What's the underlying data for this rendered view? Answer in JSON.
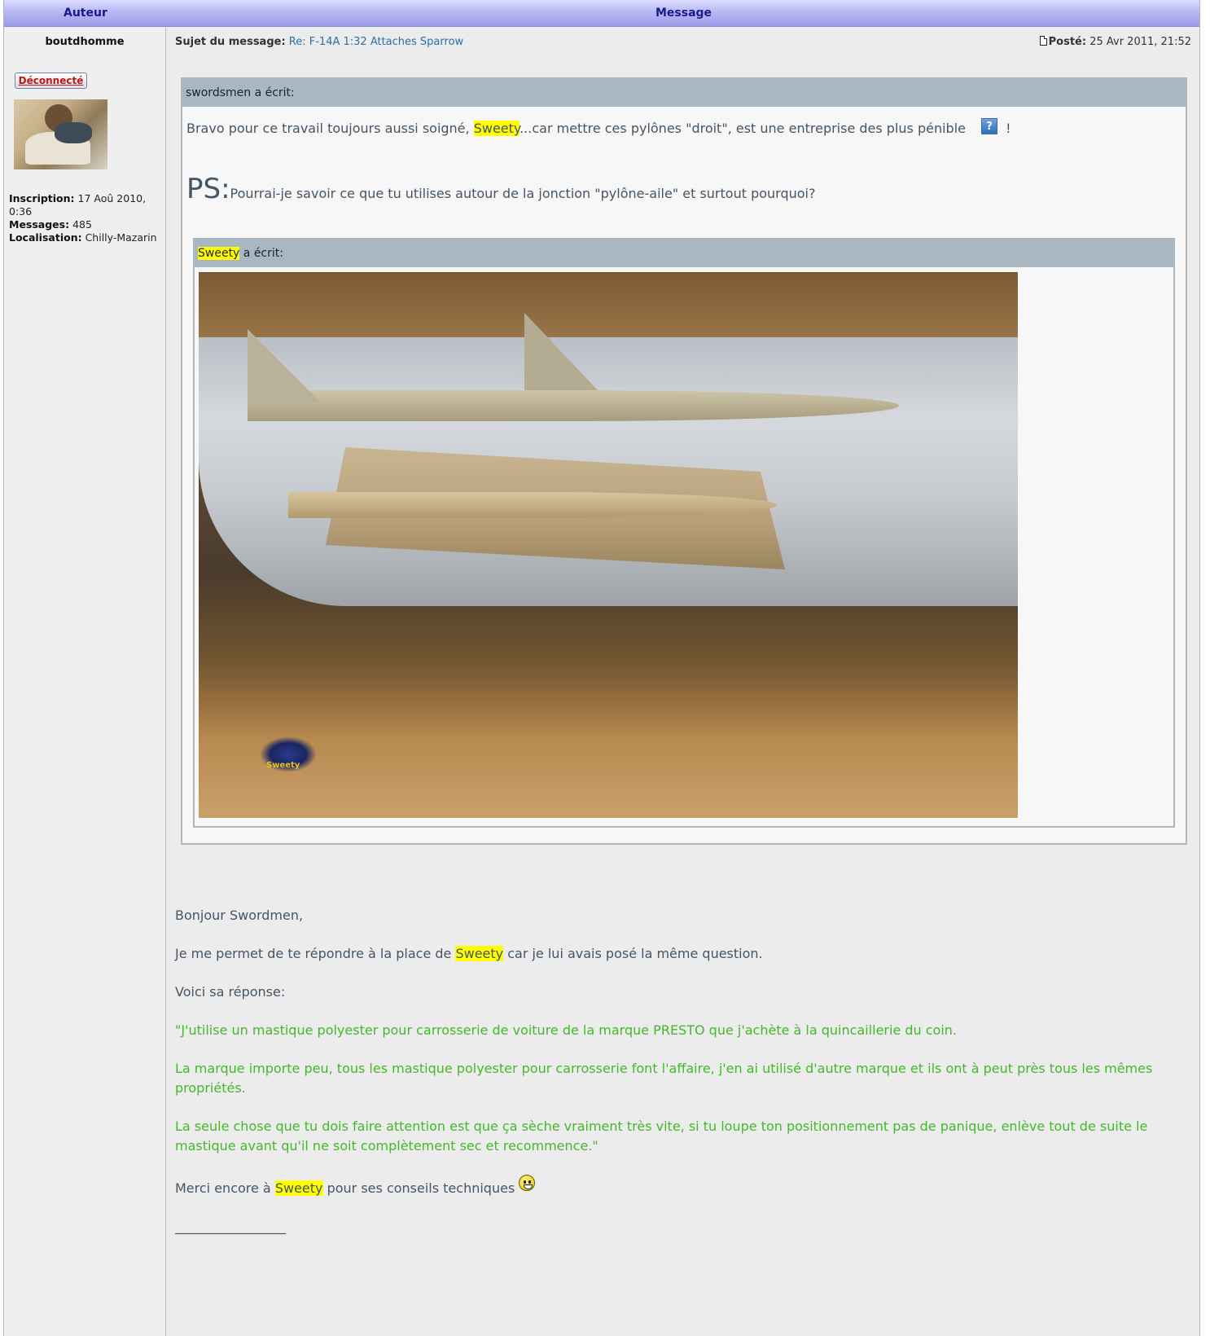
{
  "header": {
    "author_col": "Auteur",
    "message_col": "Message"
  },
  "author": {
    "name": "boutdhomme",
    "status_label": "Déconnecté",
    "inscription_label": "Inscription:",
    "inscription_value": "17 Aoû 2010, 0:36",
    "messages_label": "Messages:",
    "messages_value": "485",
    "localisation_label": "Localisation:",
    "localisation_value": "Chilly-Mazarin"
  },
  "post": {
    "subject_label": "Sujet du message:",
    "subject_value": "Re: F-14A 1:32 Attaches Sparrow",
    "posted_label": "Posté:",
    "posted_value": "25 Avr 2011, 21:52"
  },
  "quote_outer": {
    "author_line": "swordsmen a écrit:",
    "text_before": "Bravo pour ce travail toujours aussi soigné, ",
    "highlight": "Sweety",
    "text_after": "...car mettre ces pylônes \"droit\", est une entreprise des plus pénible",
    "end_mark": "!",
    "ps_big": "PS:",
    "ps_text": "Pourrai-je savoir ce que tu utilises autour de la jonction \"pylône-aile\" et surtout pourquoi?"
  },
  "quote_inner": {
    "author_highlight": "Sweety",
    "author_suffix": " a écrit:",
    "image_watermark": "Sweety"
  },
  "reply": {
    "greeting": "Bonjour Swordmen,",
    "line2_before": "Je me permet de te répondre à la place de ",
    "line2_highlight": "Sweety",
    "line2_after": " car je lui avais posé la même question.",
    "line3": "Voici sa réponse:",
    "green1": "\"J'utilise un mastique polyester pour carrosserie de voiture de la marque PRESTO que j'achète à la quincaillerie du coin.",
    "green2": "La marque importe peu, tous les mastique polyester pour carrosserie font l'affaire, j'en ai utilisé d'autre marque et ils ont à peut près tous les mêmes propriétés.",
    "green3": "La seule chose que tu dois faire attention est que ça sèche vraiment très vite, si tu loupe ton positionnement pas de panique, enlève tout de suite le mastique avant qu'il ne soit complètement sec et recommence.\"",
    "thanks_before": "Merci encore à ",
    "thanks_highlight": "Sweety",
    "thanks_after": " pour ses conseils techniques ",
    "signature_rule": "_________________"
  },
  "colors": {
    "header_text": "#1a1a8c",
    "highlight": "#ffff00",
    "green_text": "#44b82c",
    "link": "#2a6fa8",
    "status_red": "#c41414"
  },
  "icons": [
    "document-icon",
    "help-icon",
    "smiley-icon"
  ]
}
